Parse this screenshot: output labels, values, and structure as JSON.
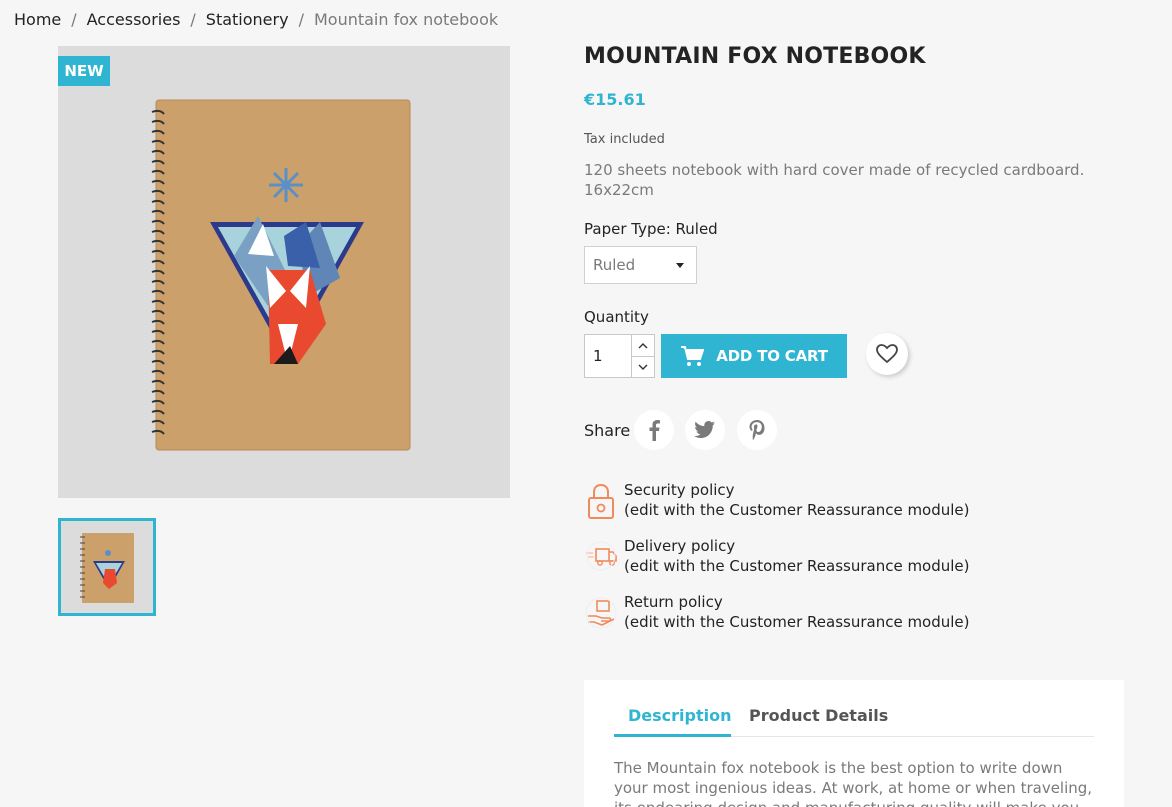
{
  "breadcrumb": {
    "items": [
      "Home",
      "Accessories",
      "Stationery"
    ],
    "current": "Mountain fox notebook",
    "separator": "/"
  },
  "badge": {
    "label": "NEW"
  },
  "product": {
    "title": "MOUNTAIN FOX NOTEBOOK",
    "price": "€15.61",
    "tax_note": "Tax included",
    "short_description": "120 sheets notebook with hard cover made of recycled cardboard. 16x22cm"
  },
  "variant": {
    "label": "Paper Type: Ruled",
    "selected": "Ruled"
  },
  "quantity": {
    "label": "Quantity",
    "value": "1"
  },
  "cart": {
    "add_label": "ADD TO CART"
  },
  "share": {
    "label": "Share"
  },
  "reassurance": [
    {
      "title": "Security policy",
      "subtitle": "(edit with the Customer Reassurance module)",
      "icon": "lock-icon"
    },
    {
      "title": "Delivery policy",
      "subtitle": "(edit with the Customer Reassurance module)",
      "icon": "delivery-truck-icon"
    },
    {
      "title": "Return policy",
      "subtitle": "(edit with the Customer Reassurance module)",
      "icon": "return-hand-icon"
    }
  ],
  "tabs": {
    "items": [
      {
        "label": "Description"
      },
      {
        "label": "Product Details"
      }
    ],
    "active": "Description",
    "description_text": "The Mountain fox notebook is the best option to write down your most ingenious ideas. At work, at home or when traveling, its endearing design and manufacturing quality will make you feel like"
  },
  "colors": {
    "accent": "#2fb5d2",
    "background": "#f6f6f6",
    "text": "#232323",
    "muted": "#7a7a7a"
  }
}
